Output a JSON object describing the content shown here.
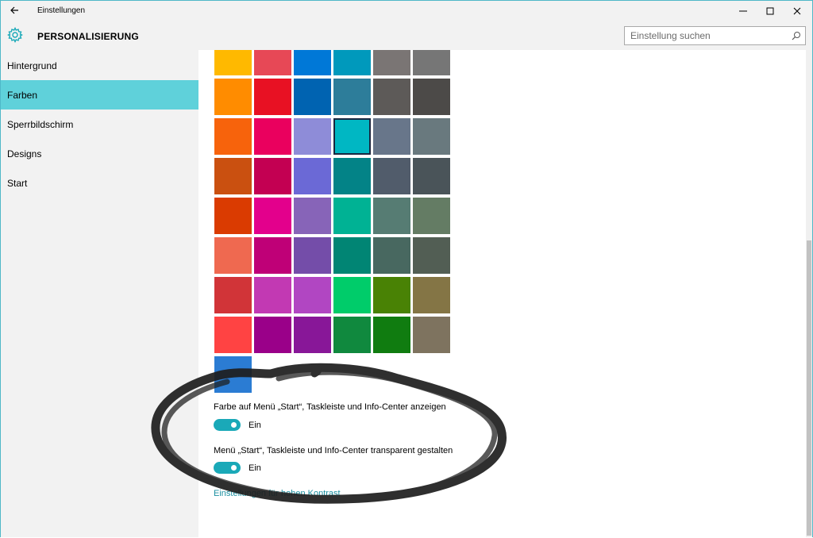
{
  "titlebar": {
    "app_title": "Einstellungen",
    "back_icon": "back-arrow-icon",
    "minimize_icon": "minimize-icon",
    "maximize_icon": "maximize-icon",
    "close_icon": "close-icon"
  },
  "header": {
    "title": "PERSONALISIERUNG",
    "icon": "gear-icon",
    "accent_color": "#1aa9b8",
    "search": {
      "placeholder": "Einstellung suchen",
      "value": "",
      "icon": "search-icon"
    }
  },
  "sidebar": {
    "items": [
      {
        "label": "Hintergrund",
        "selected": false
      },
      {
        "label": "Farben",
        "selected": true
      },
      {
        "label": "Sperrbildschirm",
        "selected": false
      },
      {
        "label": "Designs",
        "selected": false
      },
      {
        "label": "Start",
        "selected": false
      }
    ],
    "selected_color": "#5fd1da"
  },
  "palette": {
    "rows": [
      [
        "#ffb900",
        "#e74856",
        "#0078d7",
        "#0099bc",
        "#7a7574",
        "#767676"
      ],
      [
        "#ff8c00",
        "#e81123",
        "#0063b1",
        "#2d7d9a",
        "#5d5a58",
        "#4c4a48"
      ],
      [
        "#f7630c",
        "#ea005e",
        "#8e8cd8",
        "#00b7c3",
        "#68768a",
        "#69797e"
      ],
      [
        "#ca5010",
        "#c30052",
        "#6b69d6",
        "#038387",
        "#515c6b",
        "#4a5459"
      ],
      [
        "#da3b01",
        "#e3008c",
        "#8764b8",
        "#00b294",
        "#567c73",
        "#647c64"
      ],
      [
        "#ef6950",
        "#bf0077",
        "#744da9",
        "#018574",
        "#486860",
        "#525e54"
      ],
      [
        "#d13438",
        "#c239b3",
        "#b146c2",
        "#00cc6a",
        "#498205",
        "#847545"
      ],
      [
        "#ff4343",
        "#9a0089",
        "#881798",
        "#10893e",
        "#107c10",
        "#7e735f"
      ],
      [
        "#2b7cd3"
      ]
    ],
    "selected": "#00b7c3"
  },
  "options": [
    {
      "label": "Farbe auf Menü „Start“, Taskleiste und Info-Center anzeigen",
      "state": "Ein",
      "on": true
    },
    {
      "label": "Menü „Start“, Taskleiste und Info-Center transparent gestalten",
      "state": "Ein",
      "on": true
    }
  ],
  "high_contrast_link": "Einstellungen für hohen Kontrast"
}
